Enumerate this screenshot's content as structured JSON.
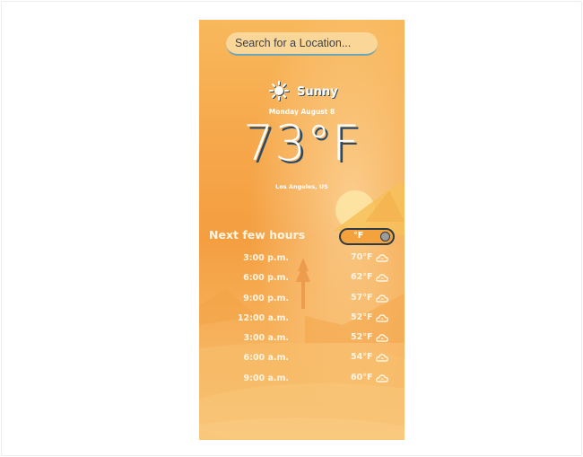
{
  "search": {
    "placeholder": "Search for a Location..."
  },
  "current": {
    "condition": "Sunny",
    "condition_icon": "sun-icon",
    "date": "Monday August 8",
    "temperature": "73°F",
    "location": "Los Angeles, US"
  },
  "forecast": {
    "title": "Next few hours",
    "unit_toggle": {
      "label": "°F",
      "state": "off"
    },
    "hours": [
      {
        "time": "3:00 p.m.",
        "temp": "70°F",
        "icon": "cloud-icon"
      },
      {
        "time": "6:00 p.m.",
        "temp": "62°F",
        "icon": "cloud-icon"
      },
      {
        "time": "9:00 p.m.",
        "temp": "57°F",
        "icon": "cloud-icon"
      },
      {
        "time": "12:00 a.m.",
        "temp": "52°F",
        "icon": "cloud-icon"
      },
      {
        "time": "3:00 a.m.",
        "temp": "52°F",
        "icon": "cloud-icon"
      },
      {
        "time": "6:00 a.m.",
        "temp": "54°F",
        "icon": "cloud-icon"
      },
      {
        "time": "9:00 a.m.",
        "temp": "60°F",
        "icon": "cloud-icon"
      }
    ]
  },
  "colors": {
    "sky_top": "#f8b85c",
    "sky_mid": "#f49e40",
    "sky_bottom": "#f8c173",
    "text_shadow": "#2d4a64",
    "search_underline": "#6aa6b6",
    "toggle_bg": "#f4a23d",
    "toggle_border": "#2e3b44"
  }
}
